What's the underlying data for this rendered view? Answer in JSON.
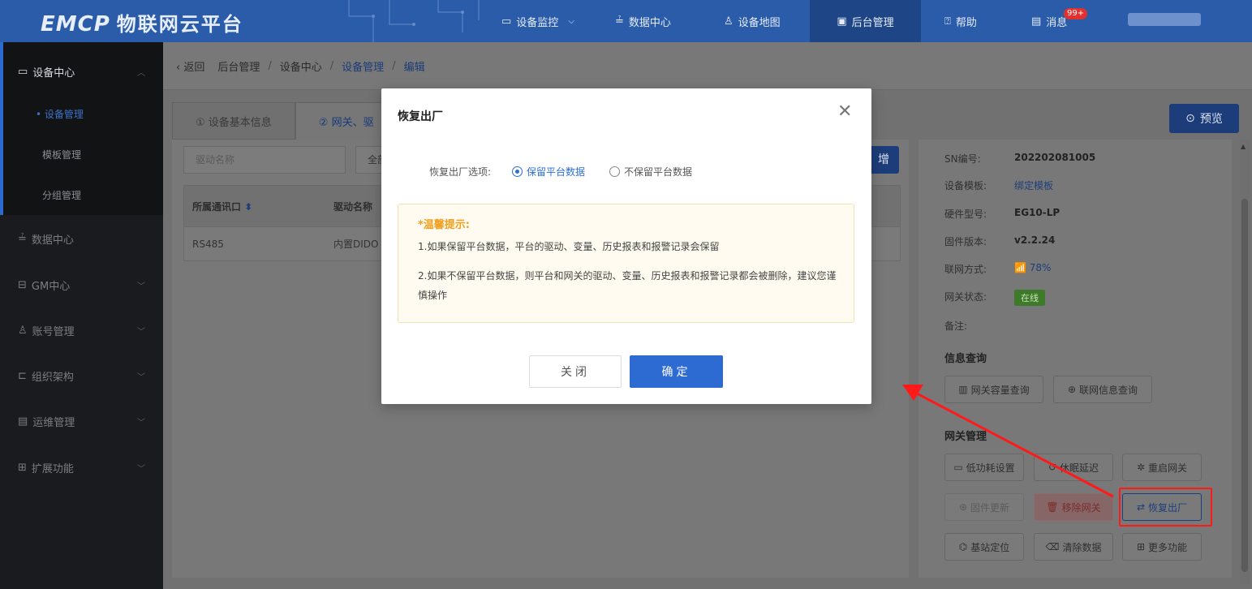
{
  "header": {
    "logo_text": "EMCP",
    "logo_cn": "物联网云平台",
    "nav": [
      {
        "label": "设备监控",
        "icon": "monitor-icon"
      },
      {
        "label": "数据中心",
        "icon": "chart-icon"
      },
      {
        "label": "设备地图",
        "icon": "map-user-icon"
      },
      {
        "label": "后台管理",
        "icon": "admin-icon"
      },
      {
        "label": "帮助",
        "icon": "help-icon"
      },
      {
        "label": "消息",
        "icon": "message-icon"
      }
    ],
    "message_badge": "99+"
  },
  "sidebar": {
    "items": [
      {
        "label": "设备中心"
      },
      {
        "label": "数据中心"
      },
      {
        "label": "GM中心"
      },
      {
        "label": "账号管理"
      },
      {
        "label": "组织架构"
      },
      {
        "label": "运维管理"
      },
      {
        "label": "扩展功能"
      }
    ],
    "sub_items": [
      "• 设备管理",
      "模板管理",
      "分组管理"
    ]
  },
  "breadcrumb": {
    "back": "返回",
    "items": [
      "后台管理",
      "设备中心",
      "设备管理",
      "编辑"
    ]
  },
  "tabs": [
    "① 设备基本信息",
    "② 网关、驱"
  ],
  "preview_label": "预览",
  "driver_panel": {
    "search_placeholder": "驱动名称",
    "select_value": "全部",
    "add_label": "增",
    "columns": [
      "所属通讯口",
      "驱动名称"
    ],
    "rows": [
      [
        "RS485",
        "内置DIDO"
      ]
    ]
  },
  "info": {
    "sn_label": "SN编号:",
    "sn_value": "202202081005",
    "template_label": "设备模板:",
    "template_value": "绑定模板",
    "hardware_label": "硬件型号:",
    "hardware_value": "EG10-LP",
    "firmware_label": "固件版本:",
    "firmware_value": "v2.2.24",
    "network_label": "联网方式:",
    "network_value": "78%",
    "status_label": "网关状态:",
    "status_value": "在线",
    "remark_label": "备注:",
    "query_title": "信息查询",
    "query_buttons": [
      "网关容量查询",
      "联网信息查询"
    ],
    "manage_title": "网关管理",
    "manage_buttons": [
      "低功耗设置",
      "休眠延迟",
      "重启网关",
      "固件更新",
      "移除网关",
      "恢复出厂",
      "基站定位",
      "清除数据",
      "更多功能"
    ]
  },
  "modal": {
    "title": "恢复出厂",
    "option_label": "恢复出厂选项:",
    "option_keep": "保留平台数据",
    "option_nokeep": "不保留平台数据",
    "tip_title": "*温馨提示:",
    "tip_1": "1.如果保留平台数据，平台的驱动、变量、历史报表和报警记录会保留",
    "tip_2": "2.如果不保留平台数据，则平台和网关的驱动、变量、历史报表和报警记录都会被删除，建议您谨慎操作",
    "cancel_label": "关闭",
    "ok_label": "确定"
  }
}
